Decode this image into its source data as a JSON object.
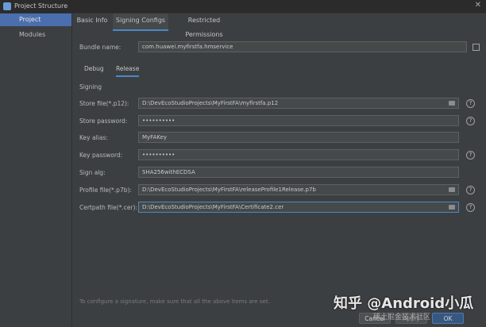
{
  "window": {
    "title": "Project Structure",
    "close_glyph": "✕"
  },
  "sidebar": {
    "items": [
      {
        "label": "Project"
      },
      {
        "label": "Modules"
      }
    ]
  },
  "tabs": [
    {
      "label": "Basic Info"
    },
    {
      "label": "Signing Configs"
    },
    {
      "label": "Restricted Permissions"
    }
  ],
  "bundle": {
    "label": "Bundle name:",
    "value": "com.huawei.myfirstfa.hmservice"
  },
  "subtabs": [
    {
      "label": "Debug"
    },
    {
      "label": "Release"
    }
  ],
  "signing": {
    "section_label": "Signing",
    "store_file": {
      "label": "Store file(*.p12):",
      "value": "D:\\DevEcoStudioProjects\\MyFirstFA\\myfirstfa.p12"
    },
    "store_password": {
      "label": "Store password:",
      "value": "••••••••••"
    },
    "key_alias": {
      "label": "Key alias:",
      "value": "MyFAKey"
    },
    "key_password": {
      "label": "Key password:",
      "value": "••••••••••"
    },
    "sign_alg": {
      "label": "Sign alg:",
      "value": "SHA256withECDSA"
    },
    "profile_file": {
      "label": "Profile file(*.p7b):",
      "value": "D:\\DevEcoStudioProjects\\MyFirstFA\\releaseProfile1Release.p7b"
    },
    "certpath_file": {
      "label": "Certpath file(*.cer):",
      "value": "D:\\DevEcoStudioProjects\\MyFirstFA\\Certificate2.cer"
    }
  },
  "footer": {
    "note": "To configure a signature, make sure that all the above items are set."
  },
  "buttons": {
    "cancel": "Cancel",
    "apply": "Apply",
    "ok": "OK"
  },
  "watermark": {
    "main": "知乎 @Android小瓜",
    "sub": "稀土掘金技术社区"
  },
  "icons": {
    "help": "?",
    "colors": {
      "accent": "#4a88c7",
      "selection": "#4b6eaf",
      "background": "#3c3f41"
    }
  }
}
